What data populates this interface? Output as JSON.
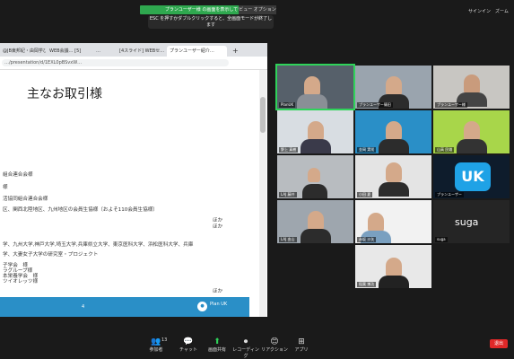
{
  "top": {
    "share_banner": "プランユーザー様 の画面を表示しています",
    "view_options": "ビュー オプション ▾",
    "esc_hint": "ESC を押すかダブルクリックすると、全画面モードが終了します",
    "signin": "サインイン",
    "zoom": "ズーム"
  },
  "browser": {
    "tabs": [
      "@JB東邦紀・由岡学び…",
      "WEB会議… [5]",
      "…",
      "[4スライド] WEBセ…",
      "プランユーザー紹介…"
    ],
    "url": "…/presentation/d/1EXL0pBSvxW…",
    "slide": {
      "title": "主なお取引様",
      "lines": [
        "組合連合会様",
        "様",
        "活協同組合連合会様",
        "区、関西北陸地区、九州地区の会員生協様（およそ110会員生協様）",
        "学、九州大学,神戸大学,埼玉大学,兵庫県立大学、東京医科大学、浜松医科大学、兵庫",
        "学、大妻女子大学の研究室・プロジェクト",
        "子学会　様",
        "本栄養学会　様",
        "ラグループ様",
        "ツイオレッツ様"
      ],
      "hoka": "ほか",
      "page_num": "4",
      "logo_text": "Plan UK"
    }
  },
  "gallery": [
    {
      "name": "PlanUK"
    },
    {
      "name": "プランユーザー篠田"
    },
    {
      "name": "プランユーザー様"
    },
    {
      "name": "野上 真樹"
    },
    {
      "name": "金岡 実咲"
    },
    {
      "name": "山高 民雄"
    },
    {
      "name": "LAJ 藤井"
    },
    {
      "name": "小田 夏"
    },
    {
      "name": "プランユーザー"
    },
    {
      "name": "LAJ 由山"
    },
    {
      "name": "赤坂 沙矢"
    },
    {
      "name": "suga"
    },
    {
      "name": "稲葉 博功"
    }
  ],
  "suga_display": "suga",
  "toolbar": {
    "items": [
      {
        "icon": "👥",
        "label": "参加者"
      },
      {
        "icon": "💬",
        "label": "チャット"
      },
      {
        "icon": "⬆",
        "label": "画面共有"
      },
      {
        "icon": "⏺",
        "label": "レコーディング"
      },
      {
        "icon": "😊",
        "label": "リアクション"
      },
      {
        "icon": "⊞",
        "label": "アプリ"
      }
    ],
    "participant_count": "13",
    "end": "退出"
  },
  "colors": {
    "accent": "#2fa84f",
    "end": "#e02828",
    "footer": "#2a8fc7"
  }
}
